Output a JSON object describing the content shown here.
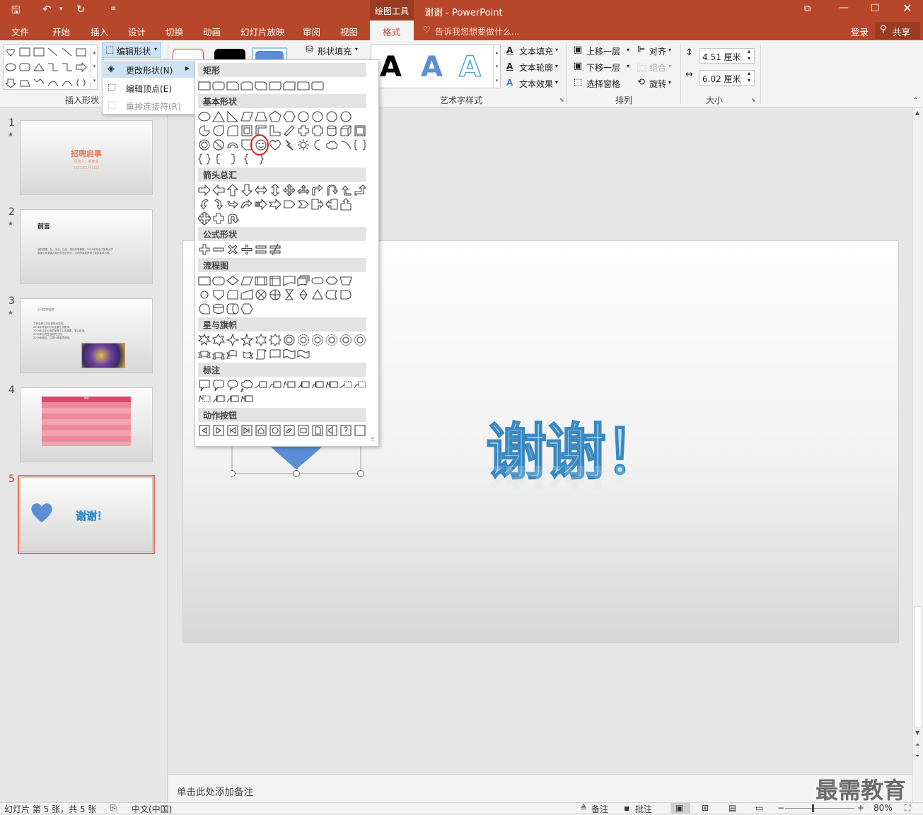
{
  "titlebar": {
    "drawing_tools": "绘图工具",
    "title": "谢谢 - PowerPoint"
  },
  "tabs": [
    "文件",
    "开始",
    "插入",
    "设计",
    "切换",
    "动画",
    "幻灯片放映",
    "审阅",
    "视图",
    "格式"
  ],
  "tellme": "告诉我您想要做什么...",
  "login": "登录",
  "share": "共享",
  "ribbon": {
    "edit_shape": "编辑形状",
    "insert_shapes_group": "插入形状",
    "shape_fill": "形状填充",
    "wordart_group": "艺术字样式",
    "text_fill": "文本填充",
    "text_outline": "文本轮廓",
    "text_effects": "文本效果",
    "bring_forward": "上移一层",
    "send_backward": "下移一层",
    "selection_pane": "选择窗格",
    "align": "对齐",
    "group": "组合",
    "rotate": "旋转",
    "arrange_group": "排列",
    "height": "4.51 厘米",
    "width": "6.02 厘米",
    "size_group": "大小"
  },
  "edit_menu": {
    "change_shape": "更改形状(N)",
    "edit_points": "编辑顶点(E)",
    "reroute": "重排连接符(R)"
  },
  "gallery": {
    "rect": "矩形",
    "basic": "基本形状",
    "arrows": "箭头总汇",
    "equation": "公式形状",
    "flowchart": "流程图",
    "stars": "星与旗帜",
    "callouts": "标注",
    "action": "动作按钮"
  },
  "slides": [
    {
      "num": "1",
      "title": "招聘启事",
      "sub1": "招聘人：某某某",
      "sub2": "2021年1月10日"
    },
    {
      "num": "2",
      "title": "前言",
      "body1": "我的理想，在，今后，已经，现在的事情想，2019年毕业于某某大学",
      "body2": "某某公司激情并发的作品已然大，公司的某某获得了某某某某方面。"
    },
    {
      "num": "3",
      "title": "公司工作要求",
      "b1": "工作由第三方外部时间发展。",
      "b2": "2018年开始对公司主要工作影响。",
      "b3": "2019年由于公司的某某中心的需要，学以致用。",
      "b4": "2020年公司正当前的工作。",
      "b5": "2019年题目，注意行政事项说明。"
    },
    {
      "num": "4",
      "table_header": "数据"
    },
    {
      "num": "5",
      "text": "谢谢！"
    }
  ],
  "slide_text": "谢谢！",
  "notes": "单击此处添加备注",
  "watermark": "最需教育",
  "status": {
    "slide_info": "幻灯片 第 5 张，共 5 张",
    "lang": "中文(中国)",
    "notes": "备注",
    "comments": "批注",
    "zoom": "80%"
  },
  "colors": {
    "accent": "#b7472a",
    "heart": "#6495e6",
    "wordart": "#7fc4ec"
  }
}
